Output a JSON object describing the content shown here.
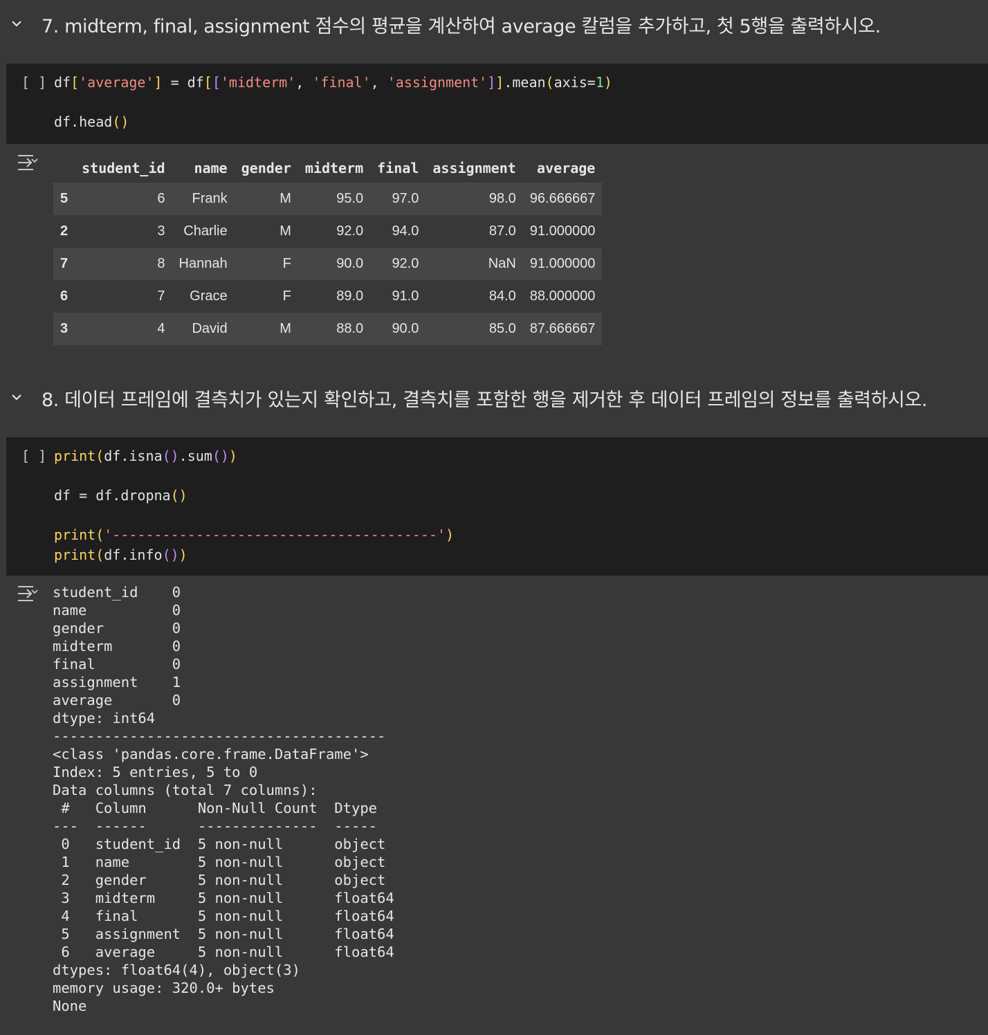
{
  "section7": {
    "title": "7. midterm, final, assignment 점수의 평균을 계산하여 average 칼럼을 추가하고, 첫 5행을 출력하시오."
  },
  "cell7": {
    "run_bracket": "[ ]",
    "code_lines": [
      "df['average'] = df[['midterm', 'final', 'assignment']].mean(axis=1)",
      "",
      "df.head()"
    ]
  },
  "output7": {
    "table": {
      "columns": [
        "",
        "student_id",
        "name",
        "gender",
        "midterm",
        "final",
        "assignment",
        "average"
      ],
      "rows": [
        [
          "5",
          "6",
          "Frank",
          "M",
          "95.0",
          "97.0",
          "98.0",
          "96.666667"
        ],
        [
          "2",
          "3",
          "Charlie",
          "M",
          "92.0",
          "94.0",
          "87.0",
          "91.000000"
        ],
        [
          "7",
          "8",
          "Hannah",
          "F",
          "90.0",
          "92.0",
          "NaN",
          "91.000000"
        ],
        [
          "6",
          "7",
          "Grace",
          "F",
          "89.0",
          "91.0",
          "84.0",
          "88.000000"
        ],
        [
          "3",
          "4",
          "David",
          "M",
          "88.0",
          "90.0",
          "85.0",
          "87.666667"
        ]
      ]
    }
  },
  "section8": {
    "title": "8. 데이터 프레임에 결측치가 있는지 확인하고, 결측치를 포함한 행을 제거한 후 데이터 프레임의 정보를 출력하시오."
  },
  "cell8": {
    "run_bracket": "[ ]",
    "code_lines": [
      "print(df.isna().sum())",
      "",
      "df = df.dropna()",
      "",
      "print('---------------------------------------')",
      "print(df.info())"
    ]
  },
  "output8": {
    "lines": [
      "student_id    0",
      "name          0",
      "gender        0",
      "midterm       0",
      "final         0",
      "assignment    1",
      "average       0",
      "dtype: int64",
      "---------------------------------------",
      "<class 'pandas.core.frame.DataFrame'>",
      "Index: 5 entries, 5 to 0",
      "Data columns (total 7 columns):",
      " #   Column      Non-Null Count  Dtype  ",
      "---  ------      --------------  -----  ",
      " 0   student_id  5 non-null      object ",
      " 1   name        5 non-null      object ",
      " 2   gender      5 non-null      object ",
      " 3   midterm     5 non-null      float64",
      " 4   final       5 non-null      float64",
      " 5   assignment  5 non-null      float64",
      " 6   average     5 non-null      float64",
      "dtypes: float64(4), object(3)",
      "memory usage: 320.0+ bytes",
      "None"
    ]
  }
}
